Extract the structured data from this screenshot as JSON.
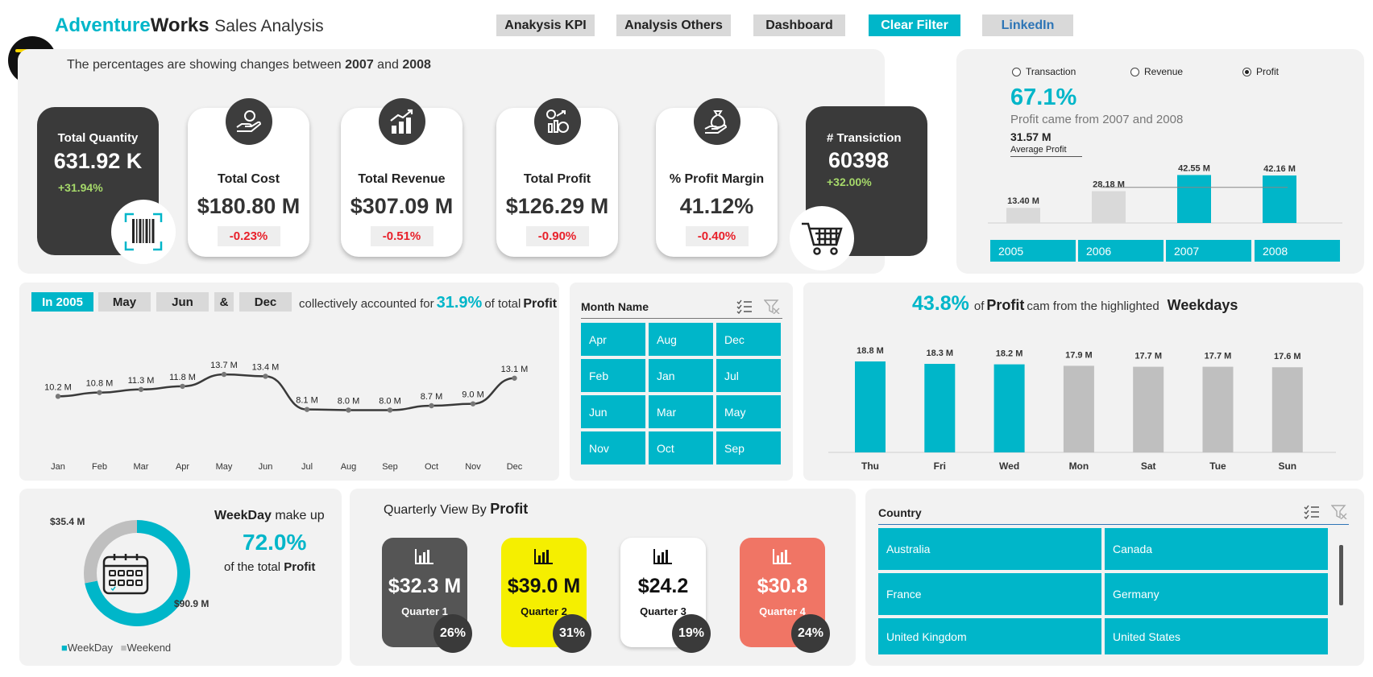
{
  "header": {
    "brand_part1": "Adventure",
    "brand_part2": "Works",
    "brand_part3": "Sales Analysis",
    "nav": [
      "Anakysis KPI",
      "Analysis Others",
      "Dashboard",
      "Clear Filter",
      "LinkedIn"
    ],
    "note_prefix": "The percentages are showing changes between",
    "note_year1": "2007",
    "note_and": "and",
    "note_year2": "2008"
  },
  "kpis": {
    "quantity": {
      "label": "Total Quantity",
      "value": "631.92  K",
      "change": "+31.94%"
    },
    "cost": {
      "label": "Total Cost",
      "value": "$180.80  M",
      "change": "-0.23%"
    },
    "revenue": {
      "label": "Total Revenue",
      "value": "$307.09  M",
      "change": "-0.51%"
    },
    "profit": {
      "label": "Total Profit",
      "value": "$126.29  M",
      "change": "-0.90%"
    },
    "margin": {
      "label": "% Profit Margin",
      "value": "41.12%",
      "change": "-0.40%"
    },
    "transactions": {
      "label": "# Transiction",
      "value": "60398",
      "change": "+32.00%"
    }
  },
  "year_panel": {
    "radios": [
      "Transaction",
      "Revenue",
      "Profit"
    ],
    "selected_radio": "Profit",
    "big_pct": "67.1%",
    "subtitle": "Profit  came from 2007  and 2008",
    "avg_value": "31.57 M",
    "avg_label": "Average Profit",
    "year_buttons": [
      "2005",
      "2006",
      "2007",
      "2008"
    ]
  },
  "month_panel": {
    "chips": [
      "In 2005",
      "May",
      "Jun",
      "&",
      "Dec"
    ],
    "text_mid": "collectively accounted for",
    "pct": "31.9%",
    "text_end": "of total",
    "metric": "Profit"
  },
  "month_slicer": {
    "title": "Month Name",
    "items": [
      "Apr",
      "Aug",
      "Dec",
      "Feb",
      "Jan",
      "Jul",
      "Jun",
      "Mar",
      "May",
      "Nov",
      "Oct",
      "Sep"
    ]
  },
  "weekday_panel": {
    "pct": "43.8%",
    "text_of": "of",
    "metric": "Profit",
    "text_mid": "cam from the highlighted",
    "text_end": "Weekdays"
  },
  "donut_panel": {
    "title_a": "WeekDay",
    "title_b": "make up",
    "pct": "72.0%",
    "text_of": "of the total",
    "metric": "Profit",
    "legend": [
      "WeekDay",
      "Weekend"
    ]
  },
  "quarter_panel": {
    "title_prefix": "Quarterly  View By",
    "metric": "Profit",
    "quarters": [
      {
        "value": "$32.3 M",
        "label": "Quarter 1",
        "pct": "26%",
        "bg": "#555555",
        "fg": "#ffffff"
      },
      {
        "value": "$39.0 M",
        "label": "Quarter 2",
        "pct": "31%",
        "bg": "#f5ef00",
        "fg": "#111111"
      },
      {
        "value": "$24.2",
        "label": "Quarter 3",
        "pct": "19%",
        "bg": "#ffffff",
        "fg": "#111111"
      },
      {
        "value": "$30.8",
        "label": "Quarter 4",
        "pct": "24%",
        "bg": "#f07565",
        "fg": "#ffffff"
      }
    ]
  },
  "country_slicer": {
    "title": "Country",
    "items": [
      "Australia",
      "Canada",
      "France",
      "Germany",
      "United Kingdom",
      "United States"
    ]
  },
  "colors": {
    "accent": "#00b6c9",
    "gray_bar": "#bfbfbf",
    "dark": "#3a3a3a",
    "negative": "#e8202a",
    "positive": "#a6d96a"
  },
  "chart_data": [
    {
      "type": "bar",
      "categories": [
        "2005",
        "2006",
        "2007",
        "2008"
      ],
      "values": [
        13.4,
        28.18,
        42.55,
        42.16
      ],
      "labels": [
        "13.40 M",
        "28.18 M",
        "42.55 M",
        "42.16 M"
      ],
      "highlighted": [
        false,
        false,
        true,
        true
      ],
      "reference_line": 31.57,
      "ylim": [
        0,
        45
      ]
    },
    {
      "type": "line",
      "categories": [
        "Jan",
        "Feb",
        "Mar",
        "Apr",
        "May",
        "Jun",
        "Jul",
        "Aug",
        "Sep",
        "Oct",
        "Nov",
        "Dec"
      ],
      "values": [
        10.2,
        10.8,
        11.3,
        11.8,
        13.7,
        13.4,
        8.1,
        8.0,
        8.0,
        8.7,
        9.0,
        13.1
      ],
      "labels": [
        "10.2 M",
        "10.8 M",
        "11.3 M",
        "11.8 M",
        "13.7 M",
        "13.4 M",
        "8.1 M",
        "8.0 M",
        "8.0 M",
        "8.7 M",
        "9.0 M",
        "13.1 M"
      ],
      "ylim": [
        6,
        15
      ]
    },
    {
      "type": "bar",
      "categories": [
        "Thu",
        "Fri",
        "Wed",
        "Mon",
        "Sat",
        "Tue",
        "Sun"
      ],
      "values": [
        18.8,
        18.3,
        18.2,
        17.9,
        17.7,
        17.7,
        17.6
      ],
      "labels": [
        "18.8 M",
        "18.3 M",
        "18.2 M",
        "17.9 M",
        "17.7 M",
        "17.7 M",
        "17.6 M"
      ],
      "highlighted": [
        true,
        true,
        true,
        false,
        false,
        false,
        false
      ],
      "ylim": [
        0,
        20
      ]
    },
    {
      "type": "pie",
      "categories": [
        "WeekDay",
        "Weekend"
      ],
      "values": [
        90.9,
        35.4
      ],
      "labels": [
        "$90.9 M",
        "$35.4 M"
      ]
    }
  ]
}
